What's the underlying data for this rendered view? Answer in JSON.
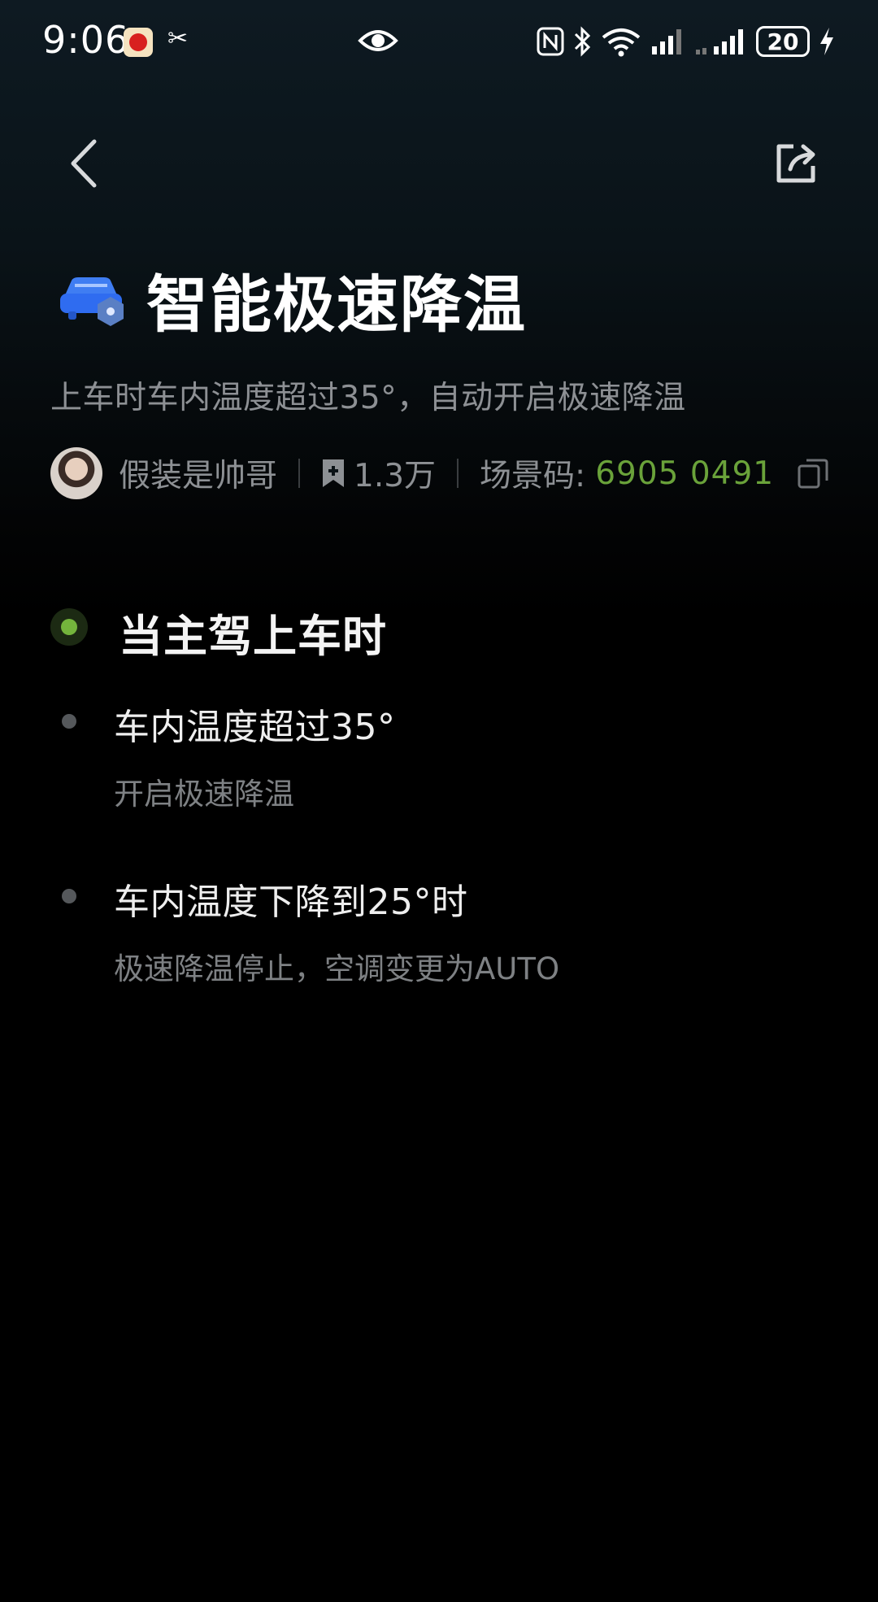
{
  "status_bar": {
    "time": "9:06",
    "battery_level": "20",
    "icons": [
      "app-icon-1",
      "app-icon-2",
      "eye-icon",
      "nfc-icon",
      "bluetooth-icon",
      "wifi-icon",
      "signal-icon",
      "signal-icon-2",
      "battery-icon",
      "charging-icon"
    ]
  },
  "nav": {
    "back_icon": "chevron-left-icon",
    "share_icon": "share-icon"
  },
  "scene": {
    "icon": "car-icon",
    "title": "智能极速降温",
    "description": "上车时车内温度超过35°，自动开启极速降温",
    "author": "假装是帅哥",
    "bookmark_count": "1.3万",
    "scene_code_label": "场景码:",
    "scene_code": "6905 0491"
  },
  "trigger": {
    "title": "当主驾上车时"
  },
  "steps": [
    {
      "title": "车内温度超过35°",
      "subtitle": "开启极速降温"
    },
    {
      "title": "车内温度下降到25°时",
      "subtitle": "极速降温停止，空调变更为AUTO"
    }
  ],
  "colors": {
    "accent_green": "#6aa23a",
    "trigger_dot": "#74b43c",
    "car_icon_blue": "#2f6cf0"
  }
}
